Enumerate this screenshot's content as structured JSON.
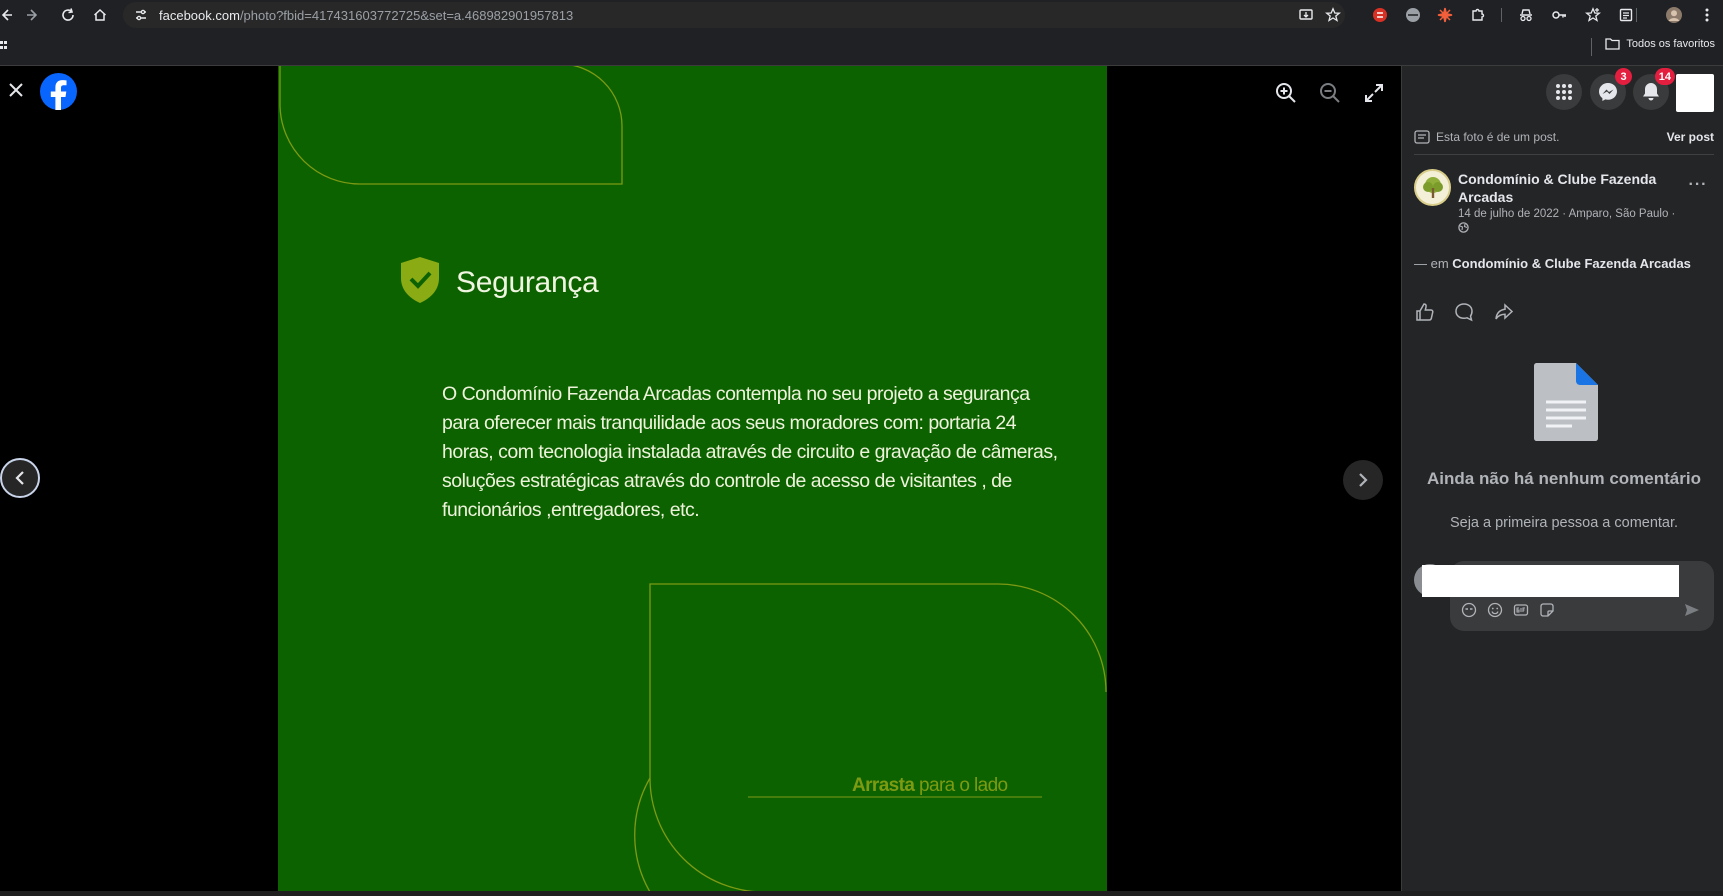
{
  "browser": {
    "url_host": "facebook.com",
    "url_path": "/photo?fbid=417431603772725&set=a.468982901957813",
    "bookmarks_folder": "Todos os favoritos"
  },
  "photo": {
    "title": "Segurança",
    "body": "O Condomínio Fazenda Arcadas contempla no seu projeto a segurança para oferecer mais tranquilidade aos seus moradores com: portaria 24 horas, com tecnologia instalada através de circuito e gravação de câmeras, soluções estratégicas através do controle de acesso de visitantes , de funcionários ,entregadores, etc.",
    "swipe_bold": "Arrasta",
    "swipe_rest": " para o lado",
    "background_color": "#0d6200",
    "accent_color": "#7d9a13"
  },
  "panel": {
    "messenger_badge": "3",
    "notifications_badge": "14",
    "post_note": "Esta foto é de um post.",
    "view_post": "Ver post",
    "page_name": "Condomínio & Clube Fazenda Arcadas",
    "post_meta": "14 de julho de 2022 · Amparo, São Paulo ·",
    "tagged_prefix": "— em ",
    "tagged_place": "Condomínio & Clube Fazenda Arcadas",
    "empty_title": "Ainda não há nenhum comentário",
    "empty_sub": "Seja a primeira pessoa a comentar."
  }
}
